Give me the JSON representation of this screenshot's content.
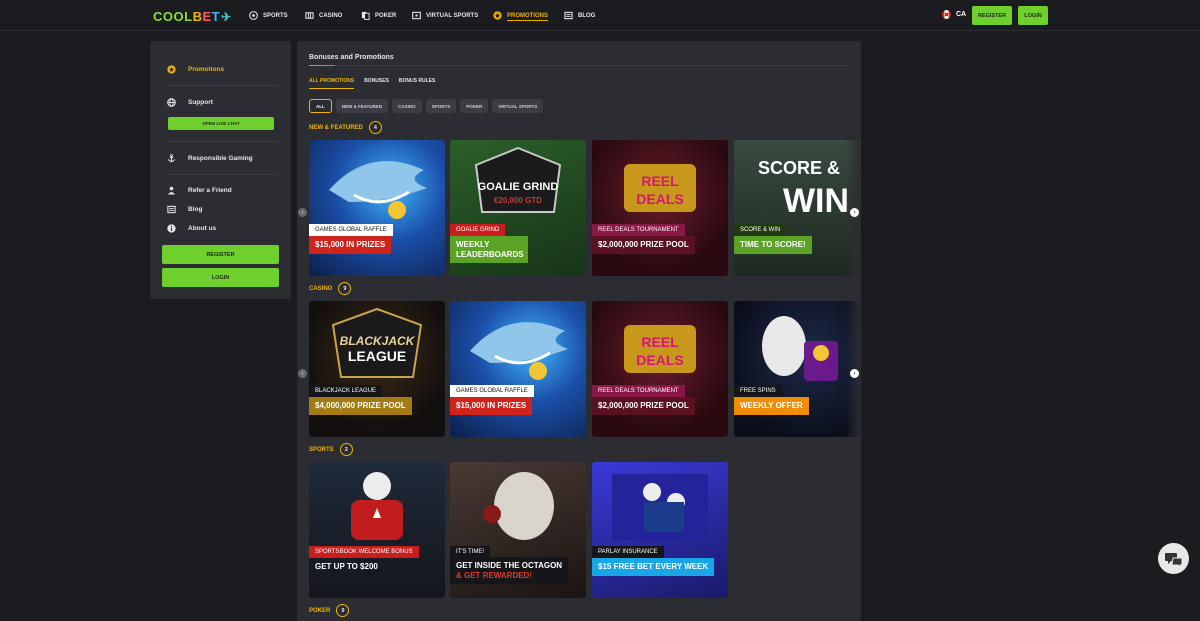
{
  "brand": {
    "logo_parts": [
      "COOL",
      "B",
      "E",
      "T"
    ],
    "logo_tail": "✈"
  },
  "nav": [
    {
      "label": "SPORTS",
      "icon": "soccer-ball-icon"
    },
    {
      "label": "CASINO",
      "icon": "slot-machine-icon"
    },
    {
      "label": "POKER",
      "icon": "cards-icon"
    },
    {
      "label": "VIRTUAL SPORTS",
      "icon": "virtual-sports-icon"
    },
    {
      "label": "PROMOTIONS",
      "icon": "promotions-star-icon",
      "active": true
    },
    {
      "label": "BLOG",
      "icon": "blog-icon"
    }
  ],
  "header": {
    "country": "CA",
    "register": "REGISTER",
    "login": "LOGIN"
  },
  "sidebar": {
    "items": [
      {
        "label": "Promotions",
        "icon": "promotions-star-icon",
        "active": true
      },
      {
        "label": "Support",
        "icon": "support-globe-icon"
      },
      {
        "label": "Responsible Gaming",
        "icon": "anchor-icon"
      },
      {
        "label": "Refer a Friend",
        "icon": "refer-friend-icon"
      },
      {
        "label": "Blog",
        "icon": "blog-icon"
      },
      {
        "label": "About us",
        "icon": "info-icon"
      }
    ],
    "live_chat": "OPEN LIVE CHAT",
    "register": "REGISTER",
    "login": "LOGIN"
  },
  "main": {
    "title": "Bonuses and Promotions",
    "tabs": [
      "ALL PROMOTIONS",
      "BONUSES",
      "BONUS RULES"
    ],
    "chips": [
      "ALL",
      "NEW & FEATURED",
      "CASINO",
      "SPORTS",
      "POKER",
      "VIRTUAL SPORTS"
    ],
    "sections": [
      {
        "title": "NEW & FEATURED",
        "count": "4",
        "cards": [
          {
            "label": "GAMES GLOBAL RAFFLE",
            "cta": "$15,000 IN PRIZES"
          },
          {
            "label": "GOALIE GRIND",
            "cta": "WEEKLY LEADERBOARDS"
          },
          {
            "label": "REEL DEALS TOURNAMENT",
            "cta": "$2,000,000 PRIZE POOL"
          },
          {
            "label": "SCORE & WIN",
            "cta": "TIME TO SCORE!"
          }
        ]
      },
      {
        "title": "CASINO",
        "count": "9",
        "cards": [
          {
            "label": "BLACKJACK LEAGUE",
            "cta": "$4,000,000 PRIZE POOL"
          },
          {
            "label": "GAMES GLOBAL RAFFLE",
            "cta": "$15,000 IN PRIZES"
          },
          {
            "label": "REEL DEALS TOURNAMENT",
            "cta": "$2,000,000 PRIZE POOL"
          },
          {
            "label": "FREE SPINS",
            "cta": "WEEKLY OFFER"
          }
        ]
      },
      {
        "title": "SPORTS",
        "count": "3",
        "cards": [
          {
            "label": "SPORTSBOOK WELCOME BONUS",
            "cta": "GET UP TO $200"
          },
          {
            "label": "IT'S TIME!",
            "cta": "GET INSIDE THE OCTAGON",
            "cta2": "& GET REWARDED!"
          },
          {
            "label": "PARLAY INSURANCE",
            "cta": "$15 FREE BET EVERY WEEK"
          }
        ]
      },
      {
        "title": "POKER",
        "count": "9"
      }
    ],
    "art_text": {
      "goalie_1": "GOALIE GRIND",
      "goalie_2": "€20,000 GTD",
      "reel_1": "REEL",
      "reel_2": "DEALS",
      "score": "SCORE &",
      "win": "WIN",
      "bj_1": "BLACKJACK",
      "bj_2": "LEAGUE"
    }
  },
  "colors": {
    "accent": "#f0b400",
    "green": "#6fcf2c",
    "bg": "#1b1c20",
    "panel": "#2c2d33"
  }
}
